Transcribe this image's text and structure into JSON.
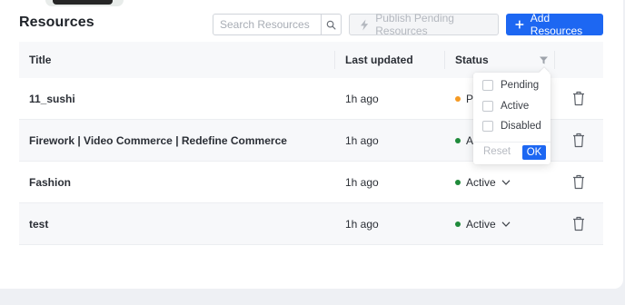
{
  "header": {
    "title": "Resources",
    "search_placeholder": "Search Resources",
    "publish_label": "Publish Pending Resources",
    "add_label": "Add Resources"
  },
  "table": {
    "columns": {
      "title": "Title",
      "last_updated": "Last updated",
      "status": "Status"
    },
    "rows": [
      {
        "title": "11_sushi",
        "updated": "1h ago",
        "status": "Pr",
        "status_color": "#f59a23"
      },
      {
        "title": "Firework | Video Commerce | Redefine Commerce",
        "updated": "1h ago",
        "status": "Ac",
        "status_color": "#1f8a3a"
      },
      {
        "title": "Fashion",
        "updated": "1h ago",
        "status": "Active",
        "status_color": "#1f8a3a"
      },
      {
        "title": "test",
        "updated": "1h ago",
        "status": "Active",
        "status_color": "#1f8a3a"
      }
    ]
  },
  "status_filter": {
    "options": [
      "Pending",
      "Active",
      "Disabled"
    ],
    "reset_label": "Reset",
    "ok_label": "OK"
  },
  "colors": {
    "primary": "#1d67f2",
    "pending": "#f59a23",
    "active": "#1f8a3a"
  }
}
